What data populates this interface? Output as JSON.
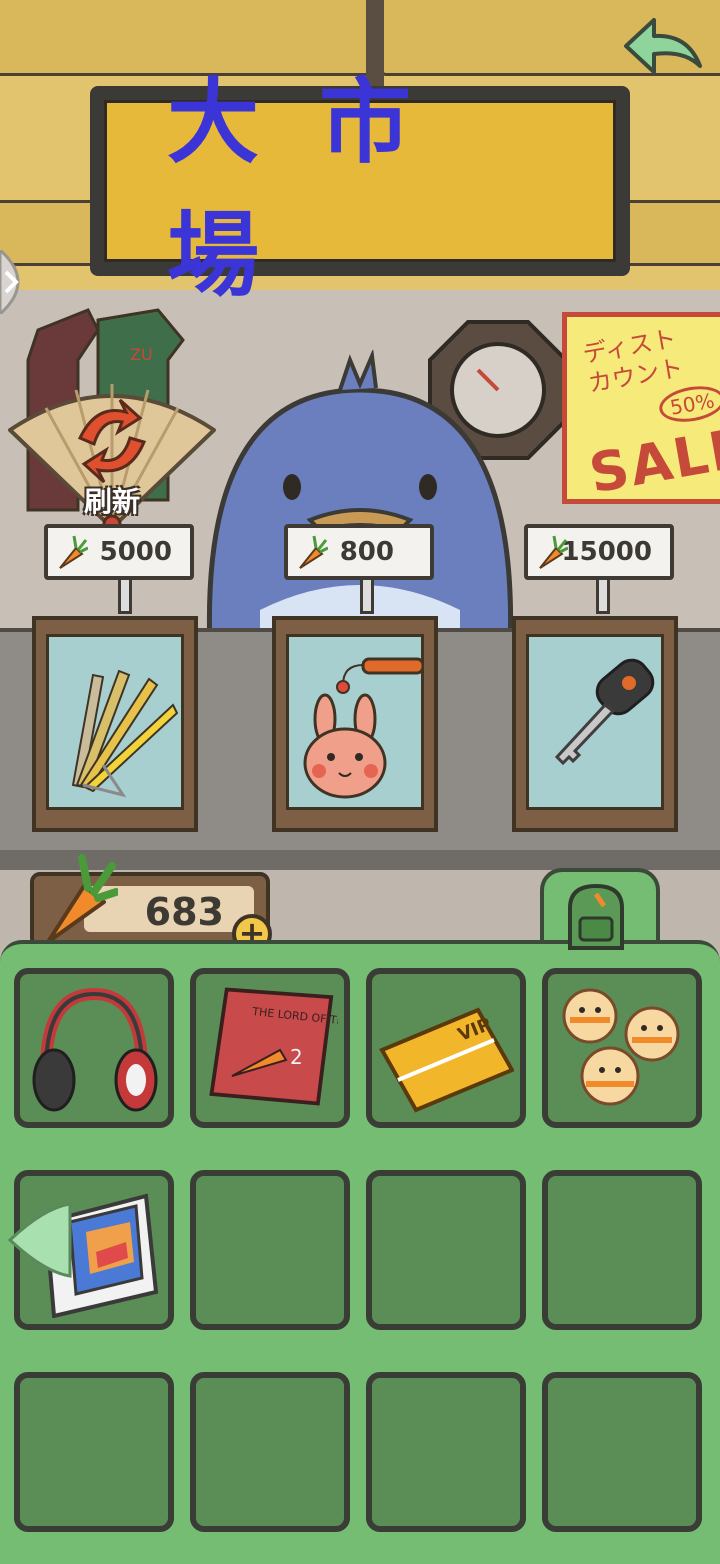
{
  "shop": {
    "title": "大市場",
    "back_icon": "back-arrow-icon",
    "refresh_label": "刷新",
    "poster": {
      "top_text": "ディスト\nカウント",
      "percent": "50%",
      "sale": "SALE"
    },
    "items": [
      {
        "name": "folding-fan",
        "price": "5000",
        "icon": "folding-fan-icon"
      },
      {
        "name": "bunny-keychain",
        "price": "800",
        "icon": "bunny-keychain-icon"
      },
      {
        "name": "car-key",
        "price": "15000",
        "icon": "car-key-icon"
      }
    ]
  },
  "currency": {
    "carrots": "683",
    "add_label": "+"
  },
  "inventory": {
    "rows": 3,
    "cols": 4,
    "items": [
      {
        "slot": 0,
        "icon": "headphones-icon"
      },
      {
        "slot": 1,
        "icon": "book-icon",
        "book_text": "THE LORD OF THE CARROTS",
        "volume": "2"
      },
      {
        "slot": 2,
        "icon": "vip-card-icon",
        "card_text": "VIP"
      },
      {
        "slot": 3,
        "icon": "animal-cookies-icon"
      },
      {
        "slot": 4,
        "icon": "phone-box-icon"
      }
    ]
  },
  "colors": {
    "sign_text": "#3b34d6",
    "inventory_bg": "#74bd72",
    "slot_bg": "#5b8e56",
    "sale_red": "#c64a3a"
  }
}
